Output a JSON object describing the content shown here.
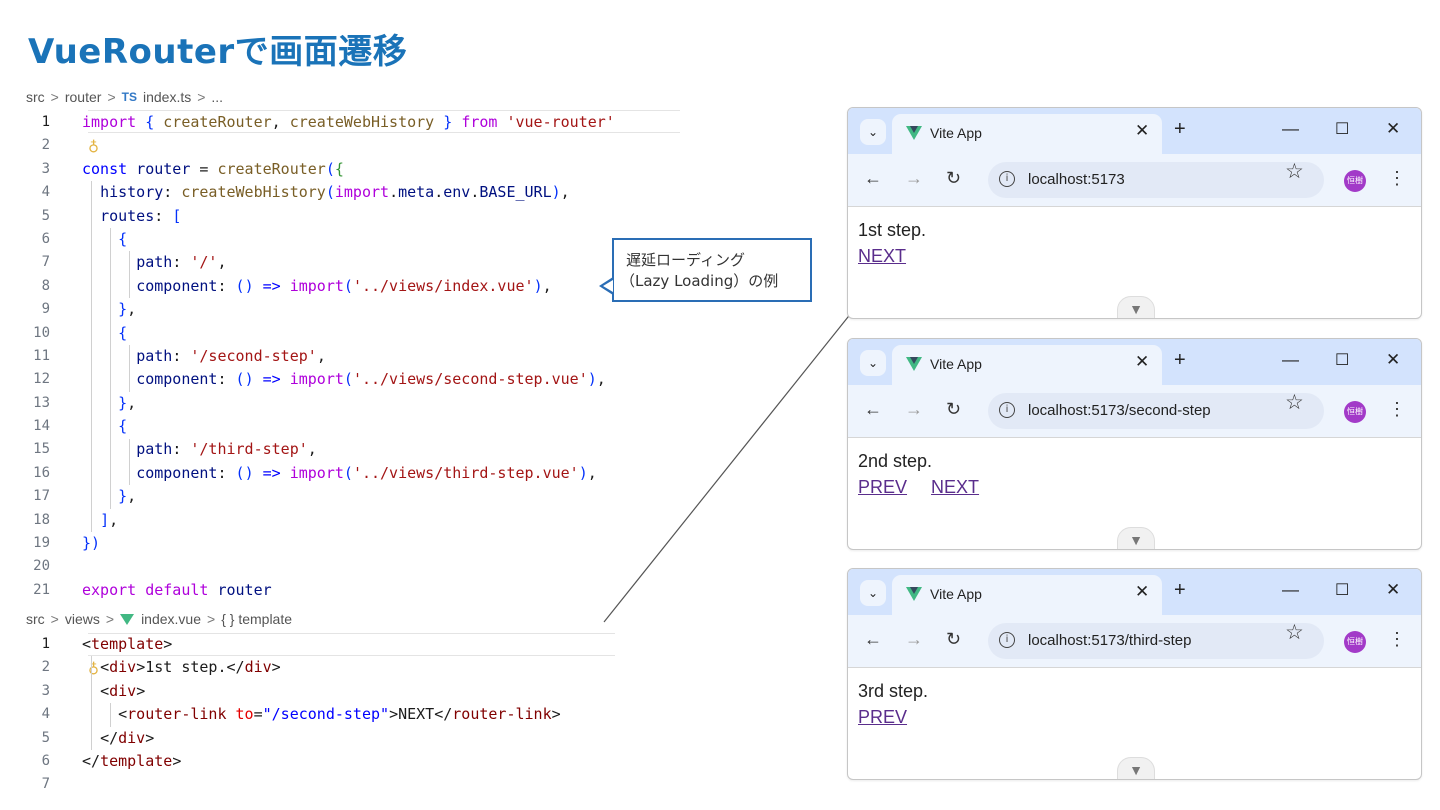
{
  "title": "VueRouterで画面遷移",
  "router_file": {
    "breadcrumb": {
      "parts": [
        "src",
        "router",
        "index.ts",
        "..."
      ],
      "lang_badge": "TS",
      "separator": ">"
    },
    "lines": [
      "import { createRouter, createWebHistory } from 'vue-router'",
      "",
      "const router = createRouter({",
      "  history: createWebHistory(import.meta.env.BASE_URL),",
      "  routes: [",
      "    {",
      "      path: '/',",
      "      component: () => import('../views/index.vue'),",
      "    },",
      "    {",
      "      path: '/second-step',",
      "      component: () => import('../views/second-step.vue'),",
      "    },",
      "    {",
      "      path: '/third-step',",
      "      component: () => import('../views/third-step.vue'),",
      "    },",
      "  ],",
      "})",
      "",
      "export default router"
    ],
    "line_numbers": [
      "1",
      "2",
      "3",
      "4",
      "5",
      "6",
      "7",
      "8",
      "9",
      "10",
      "11",
      "12",
      "13",
      "14",
      "15",
      "16",
      "17",
      "18",
      "19",
      "20",
      "21"
    ]
  },
  "view_file": {
    "breadcrumb": {
      "parts": [
        "src",
        "views",
        "index.vue",
        "{ } template"
      ],
      "separator": ">"
    },
    "lines": [
      "<template>",
      "  <div>1st step.</div>",
      "  <div>",
      "    <router-link to=\"/second-step\">NEXT</router-link>",
      "  </div>",
      "</template>",
      ""
    ],
    "line_numbers": [
      "1",
      "2",
      "3",
      "4",
      "5",
      "6",
      "7"
    ]
  },
  "callout": {
    "line1": "遅延ローディング",
    "line2": "（Lazy Loading）の例"
  },
  "browsers": [
    {
      "tab_title": "Vite App",
      "url": "localhost:5173",
      "content": "1st step.",
      "links": [
        "NEXT"
      ],
      "avatar": "恒樹"
    },
    {
      "tab_title": "Vite App",
      "url": "localhost:5173/second-step",
      "content": "2nd step.",
      "links": [
        "PREV",
        "NEXT"
      ],
      "avatar": "恒樹"
    },
    {
      "tab_title": "Vite App",
      "url": "localhost:5173/third-step",
      "content": "3rd step.",
      "links": [
        "PREV"
      ],
      "avatar": "恒樹"
    }
  ],
  "icons": {
    "tab_menu": "chevron-down-icon",
    "close": "close-icon",
    "new_tab": "plus-icon",
    "back": "arrow-left-icon",
    "forward": "arrow-right-icon",
    "reload": "reload-icon",
    "info": "info-icon",
    "bookmark": "star-icon",
    "menu": "kebab-icon",
    "scroll": "chevron-down-icon"
  },
  "colors": {
    "title": "#1a73b8",
    "callout_border": "#2a6db5",
    "vue_green": "#41b883",
    "tab_bar": "#d3e3fd",
    "link": "#5a2d8c"
  }
}
